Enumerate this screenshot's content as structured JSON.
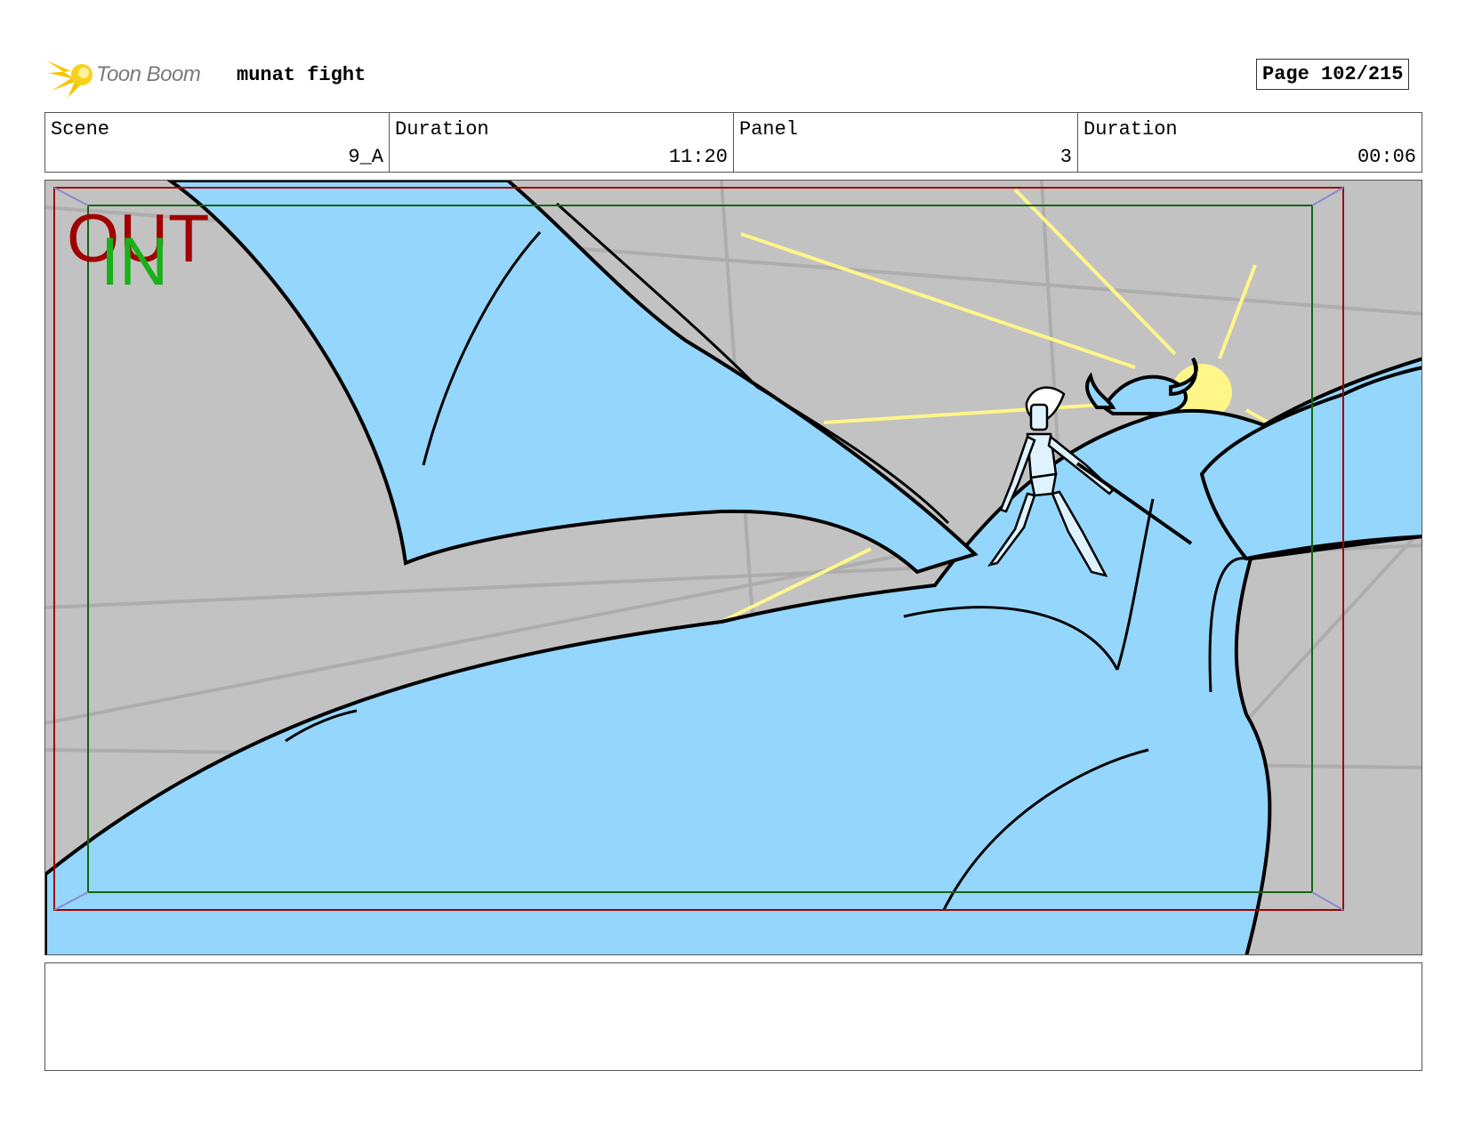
{
  "header": {
    "brand": "Toon Boom",
    "project_title": "munat fight",
    "page": "Page 102/215"
  },
  "info": {
    "scene_label": "Scene",
    "scene_value": "9_A",
    "scene_duration_label": "Duration",
    "scene_duration_value": "11:20",
    "panel_label": "Panel",
    "panel_value": "3",
    "panel_duration_label": "Duration",
    "panel_duration_value": "00:06"
  },
  "frame": {
    "out_label": "OUT",
    "in_label": "IN"
  },
  "notes": {
    "text": ""
  },
  "colors": {
    "dragon_blue": "#94d6fc",
    "background_gray": "#c2c2c2",
    "sun_yellow": "#fff68a",
    "out_frame_red": "#a10000",
    "in_frame_green": "#146414",
    "logo_yellow": "#f5c400"
  },
  "icons": [
    "toon-boom-logo-icon"
  ]
}
